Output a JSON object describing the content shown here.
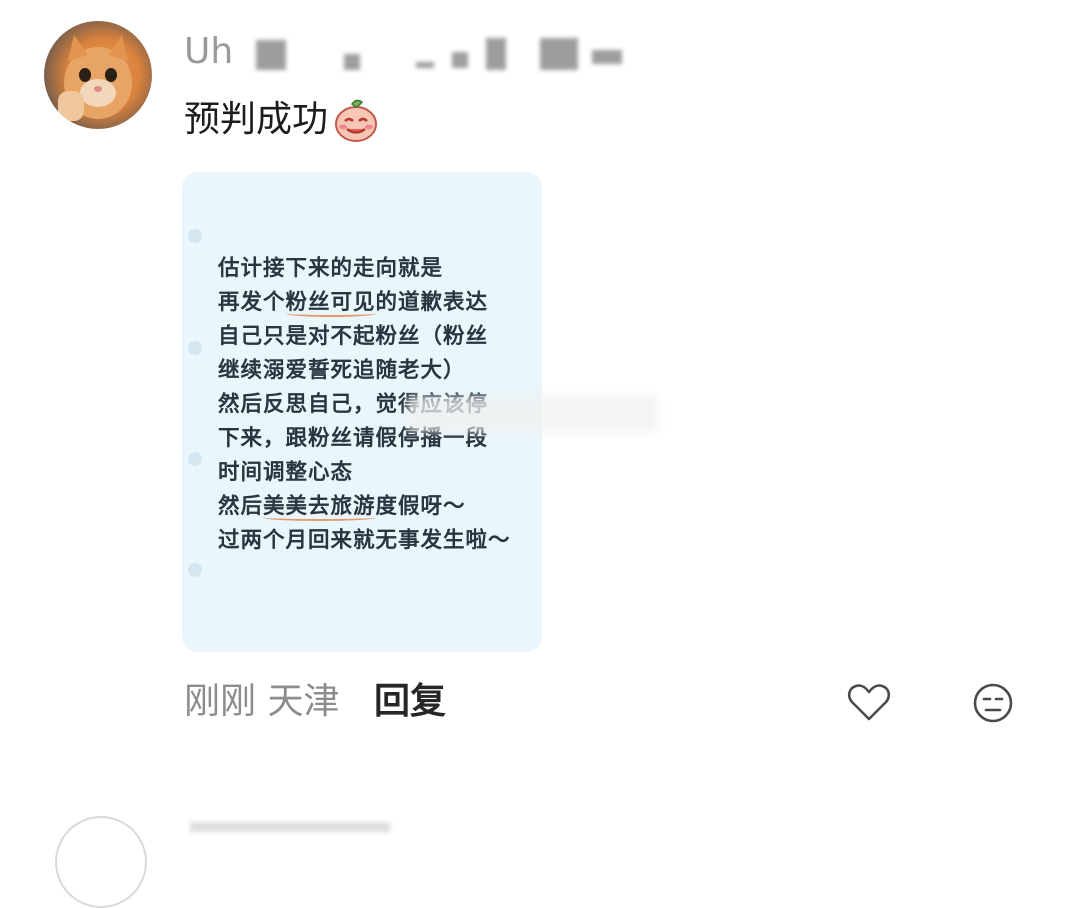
{
  "comment": {
    "author_name_partial": "Uh",
    "text": "预判成功",
    "emoji": "smiling-face-emoji"
  },
  "note_card": {
    "lines": [
      "估计接下来的走向就是",
      "再发个粉丝可见的道歉表达",
      "自己只是对不起粉丝（粉丝",
      "继续溺爱誓死追随老大）",
      "然后反思自己，觉得应该停",
      "下来，跟粉丝请假停播一段",
      "时间调整心态",
      "然后美美去旅游度假呀～",
      "过两个月回来就无事发生啦～"
    ],
    "highlights": [
      "粉丝可见",
      "美美去旅游"
    ]
  },
  "footer": {
    "time": "刚刚",
    "location": "天津",
    "reply_label": "回复",
    "like_icon": "heart-icon",
    "react_icon": "neutral-face-icon"
  },
  "colors": {
    "card_bg": "#e9f6fb",
    "highlight_underline": "#e39a6f",
    "muted_text": "#8c8c8c"
  }
}
